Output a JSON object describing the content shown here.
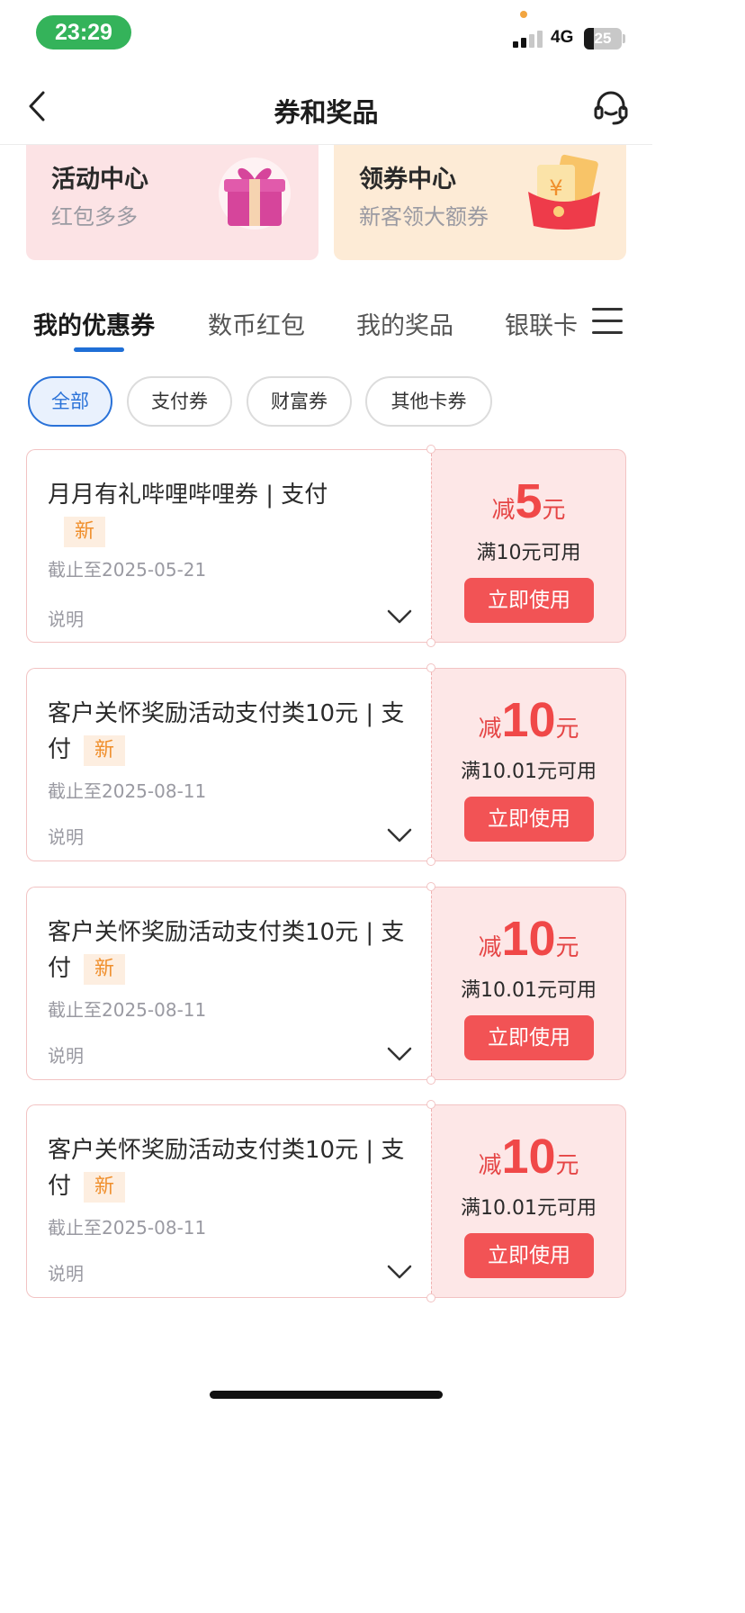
{
  "status_bar": {
    "time": "23:29",
    "network": "4G",
    "battery": "25",
    "battery_level": 0.25,
    "signal_bars": 2
  },
  "nav": {
    "title": "券和奖品",
    "back_icon": "chevron-left-icon",
    "service_icon": "headset-icon"
  },
  "promos": [
    {
      "title": "活动中心",
      "subtitle": "红包多多",
      "icon": "gift-box-icon"
    },
    {
      "title": "领券中心",
      "subtitle": "新客领大额券",
      "icon": "red-envelope-icon"
    }
  ],
  "tabs": [
    {
      "label": "我的优惠券",
      "active": true
    },
    {
      "label": "数币红包"
    },
    {
      "label": "我的奖品"
    },
    {
      "label": "银联卡"
    }
  ],
  "filters": [
    {
      "label": "全部",
      "active": true
    },
    {
      "label": "支付券"
    },
    {
      "label": "财富券"
    },
    {
      "label": "其他卡券"
    }
  ],
  "coupons": [
    {
      "title": "月月有礼哔哩哔哩券 | 支付",
      "badge": "新",
      "expiry": "截止至2025-05-21",
      "desc": "说明",
      "prefix": "减",
      "amount": "5",
      "unit": "元",
      "condition": "满10元可用",
      "button": "立即使用"
    },
    {
      "title": "客户关怀奖励活动支付类10元 | 支付",
      "badge": "新",
      "expiry": "截止至2025-08-11",
      "desc": "说明",
      "prefix": "减",
      "amount": "10",
      "unit": "元",
      "condition": "满10.01元可用",
      "button": "立即使用"
    },
    {
      "title": "客户关怀奖励活动支付类10元 | 支付",
      "badge": "新",
      "expiry": "截止至2025-08-11",
      "desc": "说明",
      "prefix": "减",
      "amount": "10",
      "unit": "元",
      "condition": "满10.01元可用",
      "button": "立即使用"
    },
    {
      "title": "客户关怀奖励活动支付类10元 | 支付",
      "badge": "新",
      "expiry": "截止至2025-08-11",
      "desc": "说明",
      "prefix": "减",
      "amount": "10",
      "unit": "元",
      "condition": "满10.01元可用",
      "button": "立即使用"
    }
  ],
  "colors": {
    "accent_blue": "#1f6fd6",
    "coupon_red": "#f25355",
    "status_green": "#34b35a",
    "badge_orange": "#f08f2c"
  }
}
